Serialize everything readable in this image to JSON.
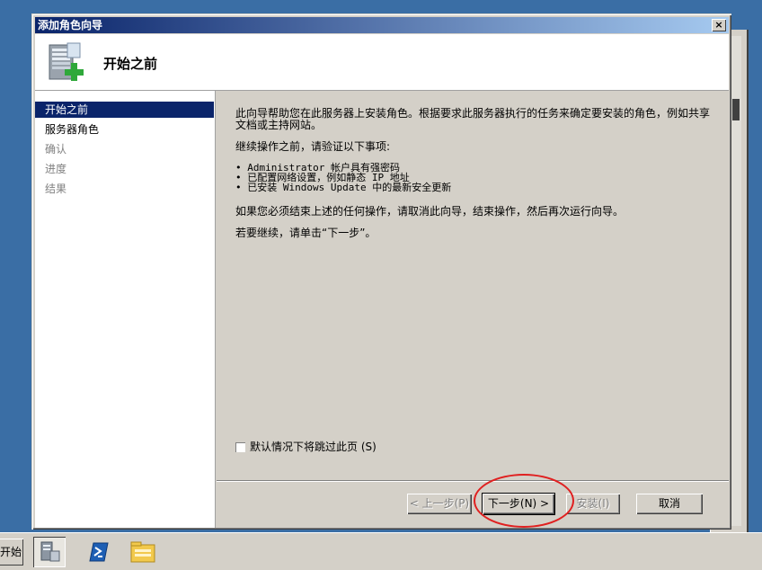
{
  "window": {
    "title": "添加角色向导",
    "close_glyph": "×"
  },
  "header": {
    "heading": "开始之前"
  },
  "nav": {
    "items": [
      {
        "label": "开始之前"
      },
      {
        "label": "服务器角色"
      },
      {
        "label": "确认"
      },
      {
        "label": "进度"
      },
      {
        "label": "结果"
      }
    ]
  },
  "content": {
    "intro": "此向导帮助您在此服务器上安装角色。根据要求此服务器执行的任务来确定要安装的角色，例如共享文档或主持网站。",
    "verify_heading": "继续操作之前，请验证以下事项:",
    "bullets": [
      "• Administrator 帐户具有强密码",
      "• 已配置网络设置，例如静态 IP 地址",
      "• 已安装 Windows Update 中的最新安全更新"
    ],
    "cancel_note": "如果您必须结束上述的任何操作，请取消此向导，结束操作，然后再次运行向导。",
    "continue_note": "若要继续，请单击“下一步”。",
    "skip_label": "默认情况下将跳过此页",
    "skip_key": "(S)"
  },
  "buttons": {
    "prev": "< 上一步(P)",
    "next": "下一步(N) >",
    "install": "安装(I)",
    "cancel": "取消"
  },
  "taskbar": {
    "start": "开始"
  },
  "colors": {
    "titlebar_start": "#0a246a",
    "titlebar_end": "#a6caf0",
    "highlight": "#e02020",
    "face": "#d4d0c8",
    "desktop": "#3a6ea5"
  }
}
